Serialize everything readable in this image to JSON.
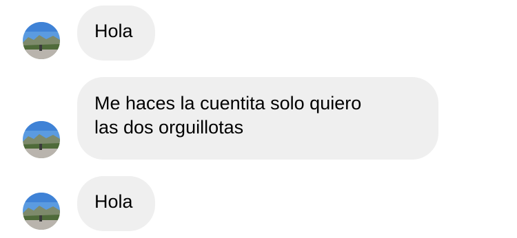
{
  "messages": [
    {
      "text": "Hola",
      "avatar_icon": "landscape-photo-avatar"
    },
    {
      "text": "Me haces la cuentita solo quiero\nlas dos orguillotas",
      "avatar_icon": "landscape-photo-avatar"
    },
    {
      "text": "Hola",
      "avatar_icon": "landscape-photo-avatar"
    }
  ],
  "colors": {
    "bubble_background": "#efefef",
    "text": "#000000",
    "page_background": "#ffffff"
  }
}
